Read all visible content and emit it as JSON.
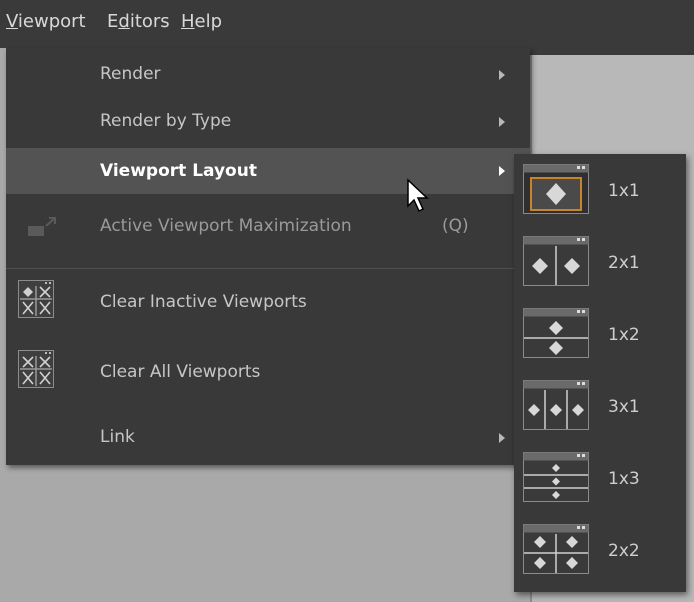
{
  "menubar": {
    "items": [
      {
        "label": "Viewport",
        "accel": "V"
      },
      {
        "label": "Editors",
        "accel": "d"
      },
      {
        "label": "Help",
        "accel": "H"
      }
    ]
  },
  "menu": {
    "items": [
      {
        "label": "Render",
        "submenu": true
      },
      {
        "label": "Render by Type",
        "submenu": true
      },
      {
        "label": "Viewport Layout",
        "submenu": true,
        "highlighted": true
      },
      {
        "label": "Active Viewport Maximization",
        "shortcut": "(Q)",
        "disabled": true,
        "icon": "maximize-icon"
      },
      {
        "label": "Clear Inactive Viewports",
        "icon": "clear-inactive-viewports-icon"
      },
      {
        "label": "Clear All Viewports",
        "icon": "clear-all-viewports-icon"
      },
      {
        "label": "Link",
        "submenu": true
      }
    ]
  },
  "layout_submenu": {
    "items": [
      {
        "label": "1x1",
        "selected": true
      },
      {
        "label": "2x1"
      },
      {
        "label": "1x2"
      },
      {
        "label": "3x1"
      },
      {
        "label": "1x3"
      },
      {
        "label": "2x2"
      }
    ]
  },
  "colors": {
    "menu_bg": "#393939",
    "highlight_bg": "#535353",
    "selected_border": "#c8842a",
    "text": "#c6c6c6"
  }
}
